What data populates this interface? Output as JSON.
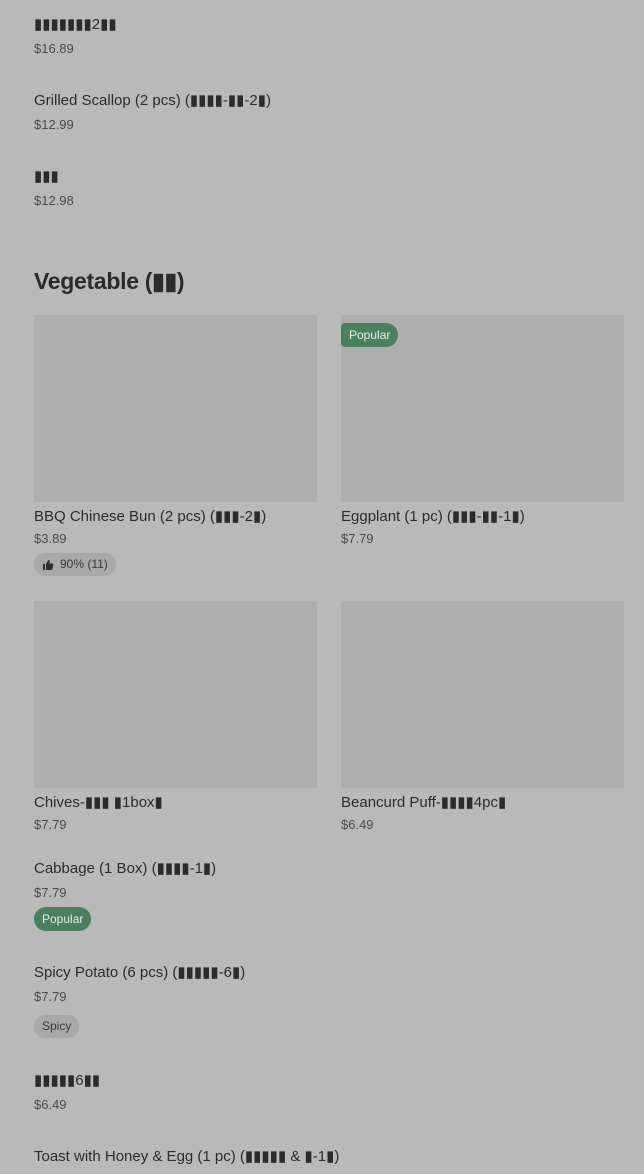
{
  "top_items": [
    {
      "name": "▮▮▮▮▮▮▮2▮▮",
      "price": "$16.89"
    },
    {
      "name": "Grilled Scallop (2 pcs) (▮▮▮▮-▮▮-2▮)",
      "price": "$12.99"
    },
    {
      "name": "▮▮▮",
      "price": "$12.98"
    }
  ],
  "section": {
    "title": "Vegetable (▮▮)"
  },
  "cards": [
    {
      "name": "BBQ Chinese Bun (2 pcs) (▮▮▮-2▮)",
      "price": "$3.89",
      "rating": "90% (11)"
    },
    {
      "name": "Eggplant (1 pc) (▮▮▮-▮▮-1▮)",
      "price": "$7.79",
      "badge": "Popular"
    },
    {
      "name": "Chives-▮▮▮ ▮1box▮",
      "price": "$7.79"
    },
    {
      "name": "Beancurd Puff-▮▮▮▮4pc▮",
      "price": "$6.49"
    }
  ],
  "list_items": [
    {
      "name": "Cabbage (1 Box) (▮▮▮▮-1▮)",
      "price": "$7.79",
      "badge": "Popular"
    },
    {
      "name": "Spicy Potato (6 pcs) (▮▮▮▮▮-6▮)",
      "price": "$7.79",
      "tag": "Spicy"
    },
    {
      "name": "▮▮▮▮▮6▮▮",
      "price": "$6.49"
    },
    {
      "name": "Toast with Honey & Egg (1 pc) (▮▮▮▮▮ & ▮-1▮)",
      "price": ""
    }
  ],
  "colors": {
    "background": "#b9b9b9",
    "image_placeholder": "#aeaeae",
    "popular_badge": "#4a7f5f"
  }
}
